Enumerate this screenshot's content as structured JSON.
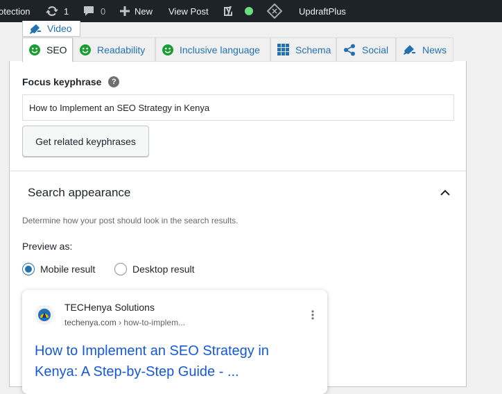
{
  "adminbar": {
    "items": [
      "otection",
      "1",
      "0",
      "New",
      "View Post",
      "UpdraftPlus"
    ]
  },
  "tabs": {
    "video": "Video",
    "seo": "SEO",
    "readability": "Readability",
    "inclusive": "Inclusive language",
    "schema": "Schema",
    "social": "Social",
    "news": "News"
  },
  "focus": {
    "label": "Focus keyphrase",
    "help": "?",
    "value": "How to Implement an SEO Strategy in Kenya",
    "related_button": "Get related keyphrases"
  },
  "search_appearance": {
    "title": "Search appearance",
    "description": "Determine how your post should look in the search results.",
    "preview_label": "Preview as:",
    "mobile": "Mobile result",
    "desktop": "Desktop result",
    "selected": "mobile"
  },
  "preview": {
    "site_name": "TECHenya Solutions",
    "domain": "techenya.com",
    "path": "› how-to-implem...",
    "title": "How to Implement an SEO Strategy in Kenya: A Step-by-Step Guide - ..."
  },
  "colors": {
    "adminbar": "#1d2327",
    "accent": "#2271b1",
    "good": "#1a9e33",
    "status_dot": "#68de7c",
    "serp_link": "#1558d6"
  }
}
